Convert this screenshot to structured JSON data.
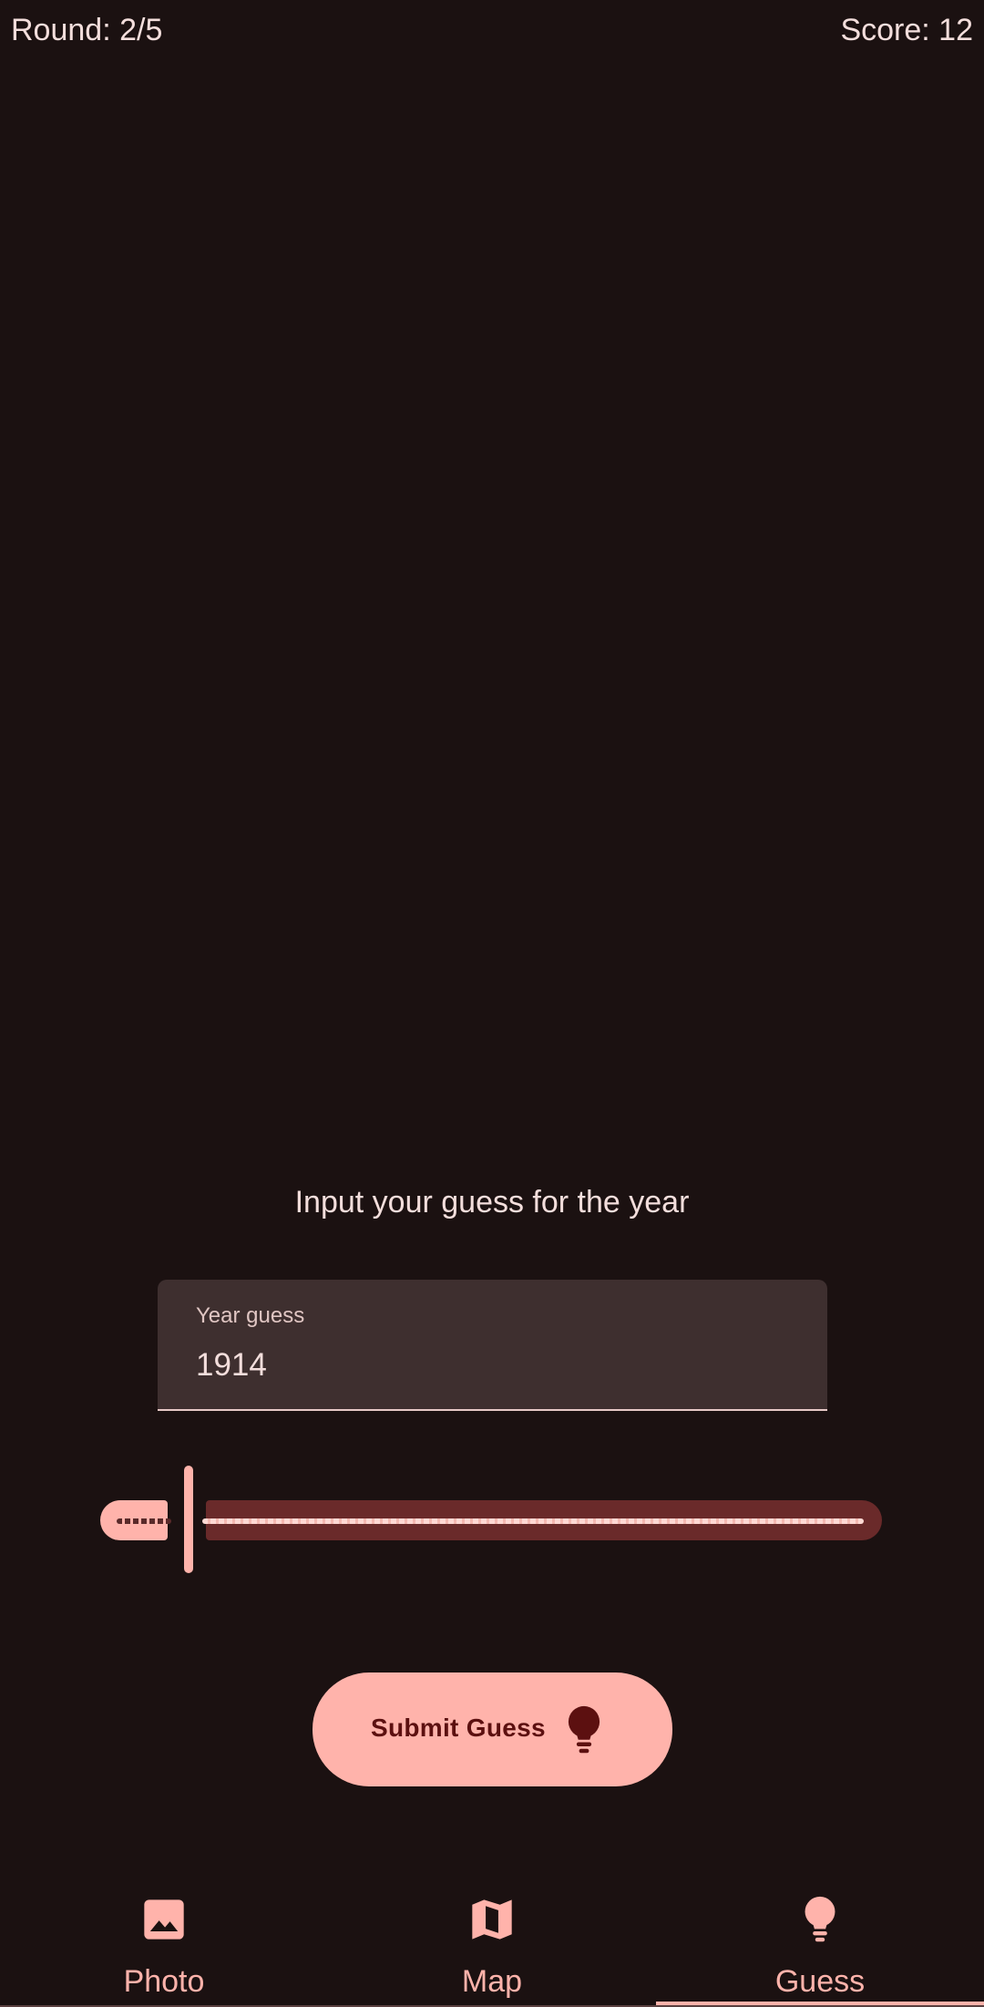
{
  "header": {
    "round_text": "Round: 2/5",
    "score_text": "Score: 12"
  },
  "guess_screen": {
    "prompt": "Input your guess for the year",
    "year_field": {
      "label": "Year guess",
      "value": "1914"
    },
    "slider": {
      "level": 0.1
    },
    "submit_button": {
      "label": "Submit Guess",
      "icon": "lightbulb-icon"
    }
  },
  "bottom_nav": {
    "items": [
      {
        "label": "Photo",
        "icon": "image-icon",
        "selected": false
      },
      {
        "label": "Map",
        "icon": "map-icon",
        "selected": false
      },
      {
        "label": "Guess",
        "icon": "lightbulb-icon",
        "selected": true
      }
    ]
  },
  "colors": {
    "background": "#1b1111",
    "accent": "#ffb3ab",
    "on_accent": "#5c1010",
    "text": "#f3dedc",
    "field_background": "#3e2f2f"
  }
}
